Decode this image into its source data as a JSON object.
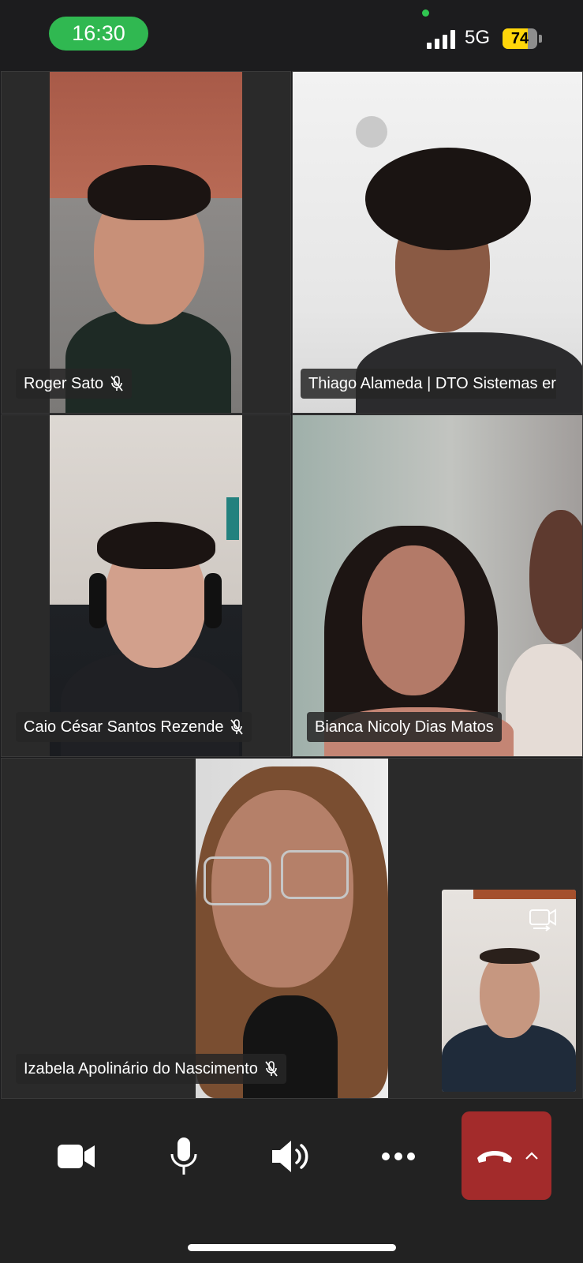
{
  "status": {
    "time": "16:30",
    "network": "5G",
    "battery": "74",
    "battery_level": 0.74,
    "accent_color": "#30b851"
  },
  "participants": [
    {
      "name": "Roger Sato",
      "muted": true
    },
    {
      "name": "Thiago Alameda | DTO Sistemas er",
      "muted": false
    },
    {
      "name": "Caio César Santos Rezende",
      "muted": true
    },
    {
      "name": "Bianca Nicoly Dias Matos",
      "muted": false
    },
    {
      "name": "Izabela Apolinário do Nascimento",
      "muted": true
    }
  ],
  "self_view": {
    "icon": "switch-camera-icon"
  },
  "controls": [
    {
      "icon": "video-camera-icon"
    },
    {
      "icon": "microphone-icon"
    },
    {
      "icon": "speaker-icon"
    },
    {
      "icon": "more-icon"
    },
    {
      "icon": "end-call-icon",
      "color": "#a32b2b"
    }
  ]
}
